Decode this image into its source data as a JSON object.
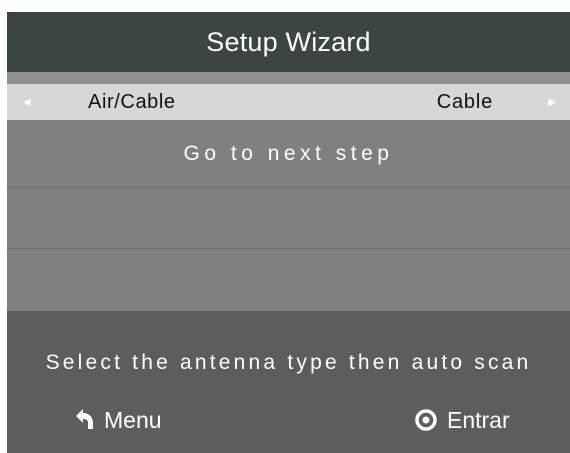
{
  "header": {
    "title": "Setup Wizard"
  },
  "option": {
    "label": "Air/Cable",
    "value": "Cable",
    "left_arrow_icon": "triangle-left-icon",
    "right_arrow_icon": "triangle-right-icon"
  },
  "menu_items": [
    {
      "label": "Go to next step"
    },
    {
      "label": ""
    },
    {
      "label": ""
    }
  ],
  "footer": {
    "hint": "Select the antenna type then auto scan",
    "back_button": {
      "label": "Menu",
      "icon": "return-arrow-icon"
    },
    "enter_button": {
      "label": "Entrar",
      "icon": "circle-dot-icon"
    }
  },
  "colors": {
    "title_bar": "#3b4543",
    "selected_row": "#d7d7d7",
    "menu_background": "#808080",
    "footer_background": "#5d5d5d",
    "text": "#ffffff"
  }
}
